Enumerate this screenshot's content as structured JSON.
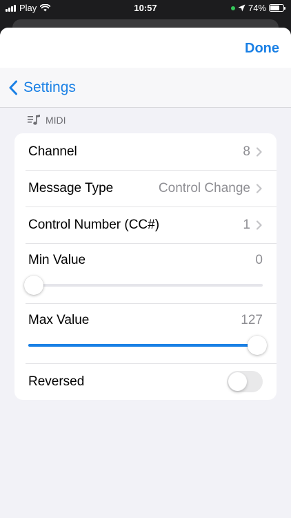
{
  "status_bar": {
    "carrier": "Play",
    "time": "10:57",
    "battery": "74%",
    "battery_level": 0.74,
    "icons": [
      "signal-icon",
      "wifi-icon",
      "location-icon",
      "battery-icon"
    ]
  },
  "header": {
    "done_label": "Done"
  },
  "nav": {
    "back_label": "Settings",
    "back_icon": "chevron-left-icon"
  },
  "section": {
    "icon": "music-list-icon",
    "title": "MIDI"
  },
  "rows": {
    "channel": {
      "label": "Channel",
      "value": "8"
    },
    "message_type": {
      "label": "Message Type",
      "value": "Control Change"
    },
    "control_number": {
      "label": "Control Number (CC#)",
      "value": "1"
    },
    "min_value": {
      "label": "Min Value",
      "value": "0",
      "slider_fraction": 0.0
    },
    "max_value": {
      "label": "Max Value",
      "value": "127",
      "slider_fraction": 1.0
    },
    "reversed": {
      "label": "Reversed",
      "on": false
    }
  },
  "colors": {
    "accent": "#1a80e5",
    "background": "#f2f2f7",
    "secondary_text": "#8e8e93"
  }
}
